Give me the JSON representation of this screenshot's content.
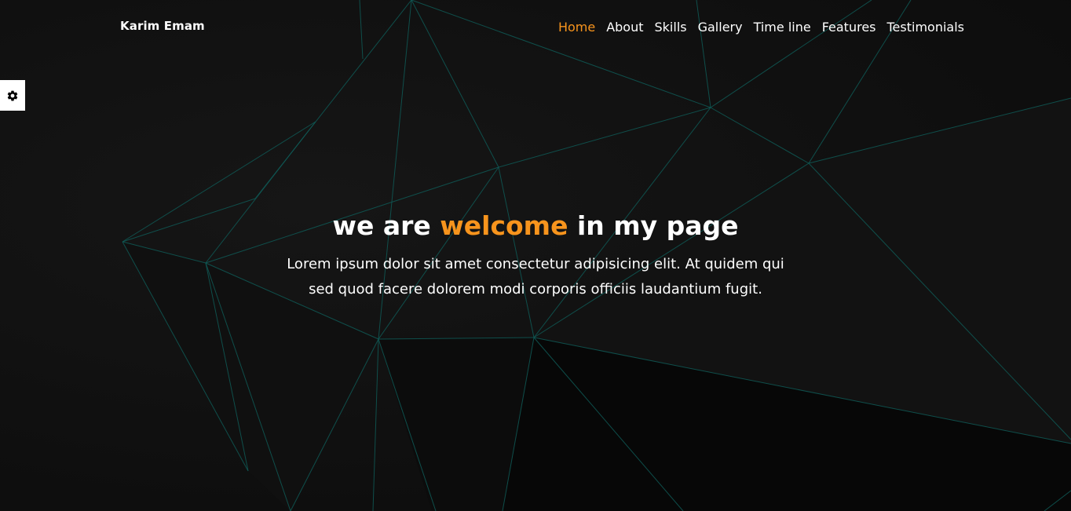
{
  "header": {
    "brand": "Karim Emam",
    "nav": [
      {
        "label": "Home",
        "active": true
      },
      {
        "label": "About",
        "active": false
      },
      {
        "label": "Skills",
        "active": false
      },
      {
        "label": "Gallery",
        "active": false
      },
      {
        "label": "Time line",
        "active": false
      },
      {
        "label": "Features",
        "active": false
      },
      {
        "label": "Testimonials",
        "active": false
      }
    ]
  },
  "settings": {
    "icon": "gear-icon"
  },
  "hero": {
    "headline_before": "we are ",
    "headline_accent": "welcome",
    "headline_after": " in my page",
    "paragraph": "Lorem ipsum dolor sit amet consectetur adipisicing elit. At quidem qui sed quod facere dolorem modi corporis officiis laudantium fugit."
  },
  "colors": {
    "accent": "#f7941d",
    "background": "#0e0e0e",
    "mesh_line": "#0f5a56",
    "text": "#ffffff"
  }
}
